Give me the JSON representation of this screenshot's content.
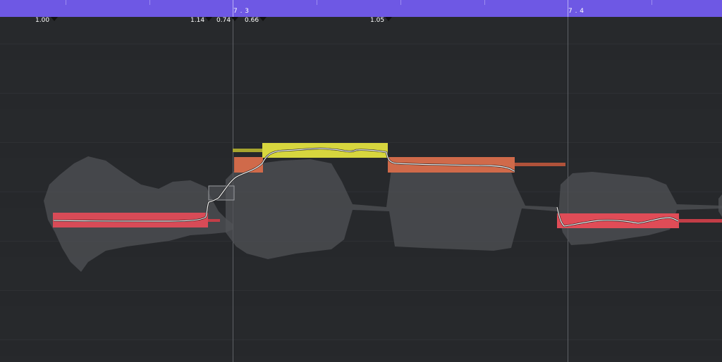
{
  "ruler": {
    "bars": [
      {
        "label": "7 . 3"
      },
      {
        "label": "7 . 4"
      }
    ]
  },
  "blob_markers": [
    "1.00",
    "1.14",
    "0.74",
    "0.66",
    "1.05"
  ],
  "note_colors": {
    "red": "#e04c57",
    "orange": "#d06a4a",
    "yellow": "#d7d63e",
    "ruler": "#6e58e4",
    "background": "#26282b"
  },
  "notes": [
    {
      "name": "note-1",
      "color": "red"
    },
    {
      "name": "note-2",
      "color": "orange"
    },
    {
      "name": "note-3",
      "color": "yellow"
    },
    {
      "name": "note-4",
      "color": "orange"
    },
    {
      "name": "note-5",
      "color": "red"
    }
  ],
  "transition_handle": {
    "icon": "transition-box"
  }
}
